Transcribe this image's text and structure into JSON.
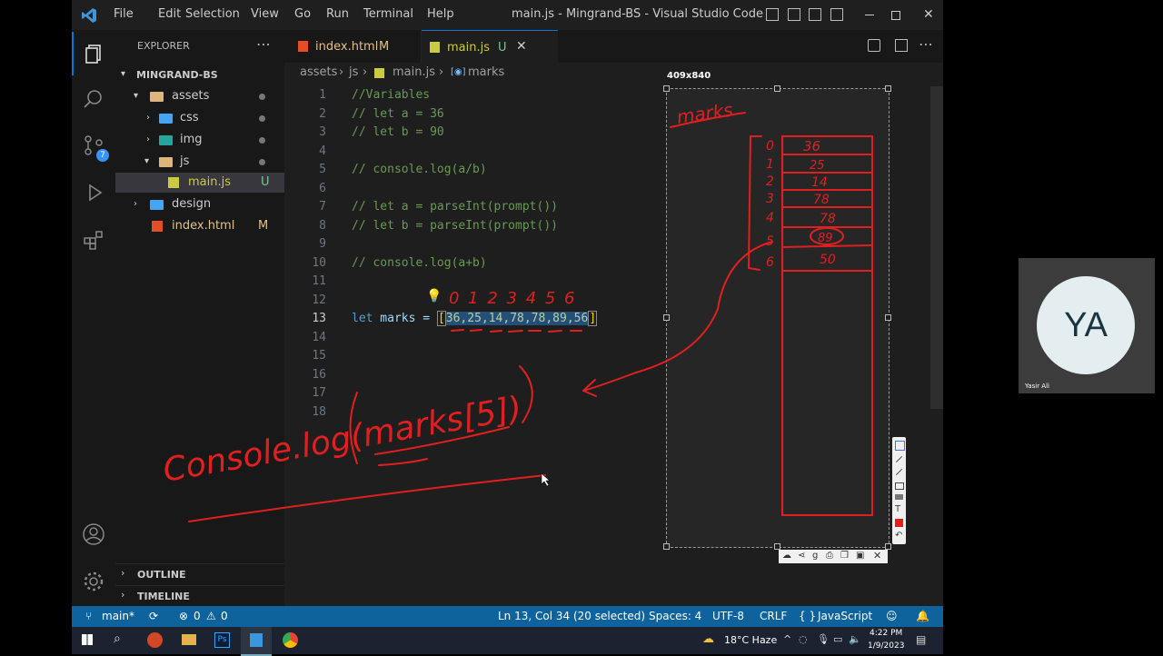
{
  "window": {
    "title": "main.js - Mingrand-BS - Visual Studio Code",
    "menu": [
      "File",
      "Edit",
      "Selection",
      "View",
      "Go",
      "Run",
      "Terminal",
      "Help"
    ]
  },
  "activity": {
    "source_control_badge": "7"
  },
  "explorer": {
    "header": "EXPLORER",
    "project": "MINGRAND-BS",
    "items": [
      {
        "label": "assets"
      },
      {
        "label": "css"
      },
      {
        "label": "img"
      },
      {
        "label": "js"
      },
      {
        "label": "main.js",
        "status": "U"
      },
      {
        "label": "design"
      },
      {
        "label": "index.html",
        "status": "M"
      }
    ],
    "outline": "OUTLINE",
    "timeline": "TIMELINE"
  },
  "tabs": [
    {
      "label": "index.html",
      "status": "M"
    },
    {
      "label": "main.js",
      "status": "U"
    }
  ],
  "breadcrumb": [
    "assets",
    "js",
    "main.js",
    "marks"
  ],
  "code": {
    "line_numbers": [
      "1",
      "2",
      "3",
      "4",
      "5",
      "6",
      "7",
      "8",
      "9",
      "10",
      "11",
      "12",
      "13",
      "14",
      "15",
      "16",
      "17",
      "18"
    ],
    "lines": [
      "//Variables",
      "// let a = 36",
      "// let b = 90",
      "",
      "// console.log(a/b)",
      "",
      "// let a = parseInt(prompt())",
      "// let b = parseInt(prompt())",
      "",
      "// console.log(a+b)",
      "",
      "",
      "",
      "",
      "",
      "",
      "",
      ""
    ],
    "line13_kw": "let",
    "line13_name": " marks = ",
    "line13_open": "[",
    "line13_sel": "36,25,14,78,78,89,56",
    "line13_close": "]"
  },
  "annotations": {
    "indices": "0 1 2 3 4 5 6",
    "handwritten": "Console.log(marks[5])",
    "panel_title": "marks",
    "array_indices": [
      "0",
      "1",
      "2",
      "3",
      "4",
      "5",
      "6"
    ],
    "array_values": [
      "36",
      "25",
      "14",
      "78",
      "78",
      "89",
      "50"
    ]
  },
  "drawing_panel": {
    "size_label": "409x840"
  },
  "status": {
    "branch": "main*",
    "errors": "0",
    "warnings": "0",
    "position": "Ln 13, Col 34 (20 selected)",
    "spaces": "Spaces: 4",
    "encoding": "UTF-8",
    "eol": "CRLF",
    "language": "JavaScript"
  },
  "taskbar": {
    "weather": "18°C  Haze",
    "time": "4:22 PM",
    "date": "1/9/2023"
  },
  "webcam": {
    "initials": "YA",
    "name": "Yasir Ali"
  },
  "colors": {
    "accent": "#0e639c",
    "ink": "#e02020",
    "html_icon": "#e44d26",
    "js_icon": "#cbcb41",
    "folder": "#dcb67a"
  }
}
